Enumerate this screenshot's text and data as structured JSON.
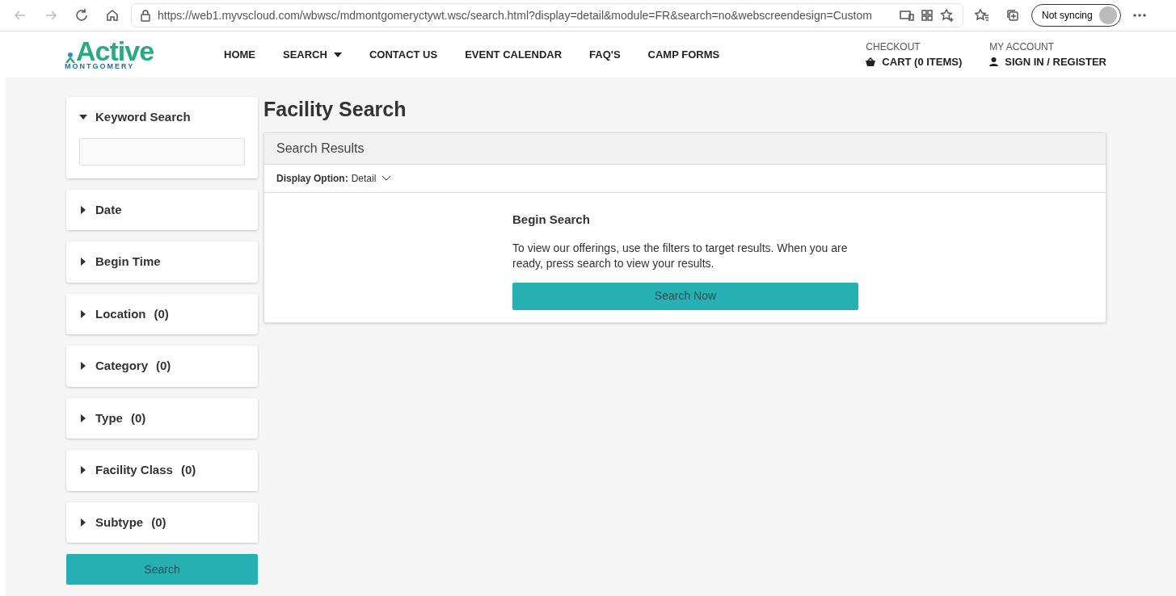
{
  "browser": {
    "url": "https://web1.myvscloud.com/wbwsc/mdmontgomeryctywt.wsc/search.html?display=detail&module=FR&search=no&webscreendesign=Custom",
    "profile_label": "Not syncing"
  },
  "logo": {
    "word": "Active",
    "sub": "MONTGOMERY"
  },
  "nav": [
    {
      "label": "HOME",
      "kind": "link"
    },
    {
      "label": "SEARCH",
      "kind": "dropdown"
    },
    {
      "label": "CONTACT US",
      "kind": "link"
    },
    {
      "label": "EVENT CALENDAR",
      "kind": "link"
    },
    {
      "label": "FAQ'S",
      "kind": "link"
    },
    {
      "label": "CAMP FORMS",
      "kind": "link"
    }
  ],
  "account": [
    {
      "heading": "CHECKOUT",
      "label": "CART (0 ITEMS)",
      "kind": "cart"
    },
    {
      "heading": "MY ACCOUNT",
      "label": "SIGN IN / REGISTER",
      "kind": "user"
    }
  ],
  "filters": [
    {
      "label": "Keyword Search",
      "expanded": true
    },
    {
      "label": "Date",
      "expanded": false
    },
    {
      "label": "Begin Time",
      "expanded": false
    },
    {
      "label": "Location",
      "count": "(0)",
      "expanded": false
    },
    {
      "label": "Category",
      "count": "(0)",
      "expanded": false
    },
    {
      "label": "Type",
      "count": "(0)",
      "expanded": false
    },
    {
      "label": "Facility Class",
      "count": "(0)",
      "expanded": false
    },
    {
      "label": "Subtype",
      "count": "(0)",
      "expanded": false
    }
  ],
  "search_button": "Search",
  "page_title": "Facility Search",
  "results": {
    "header": "Search Results",
    "display_label": "Display Option:",
    "display_value": "Detail",
    "heading": "Begin Search",
    "message": "To view our offerings, use the filters to target results. When you are ready, press search to view your results.",
    "button": "Search Now"
  }
}
